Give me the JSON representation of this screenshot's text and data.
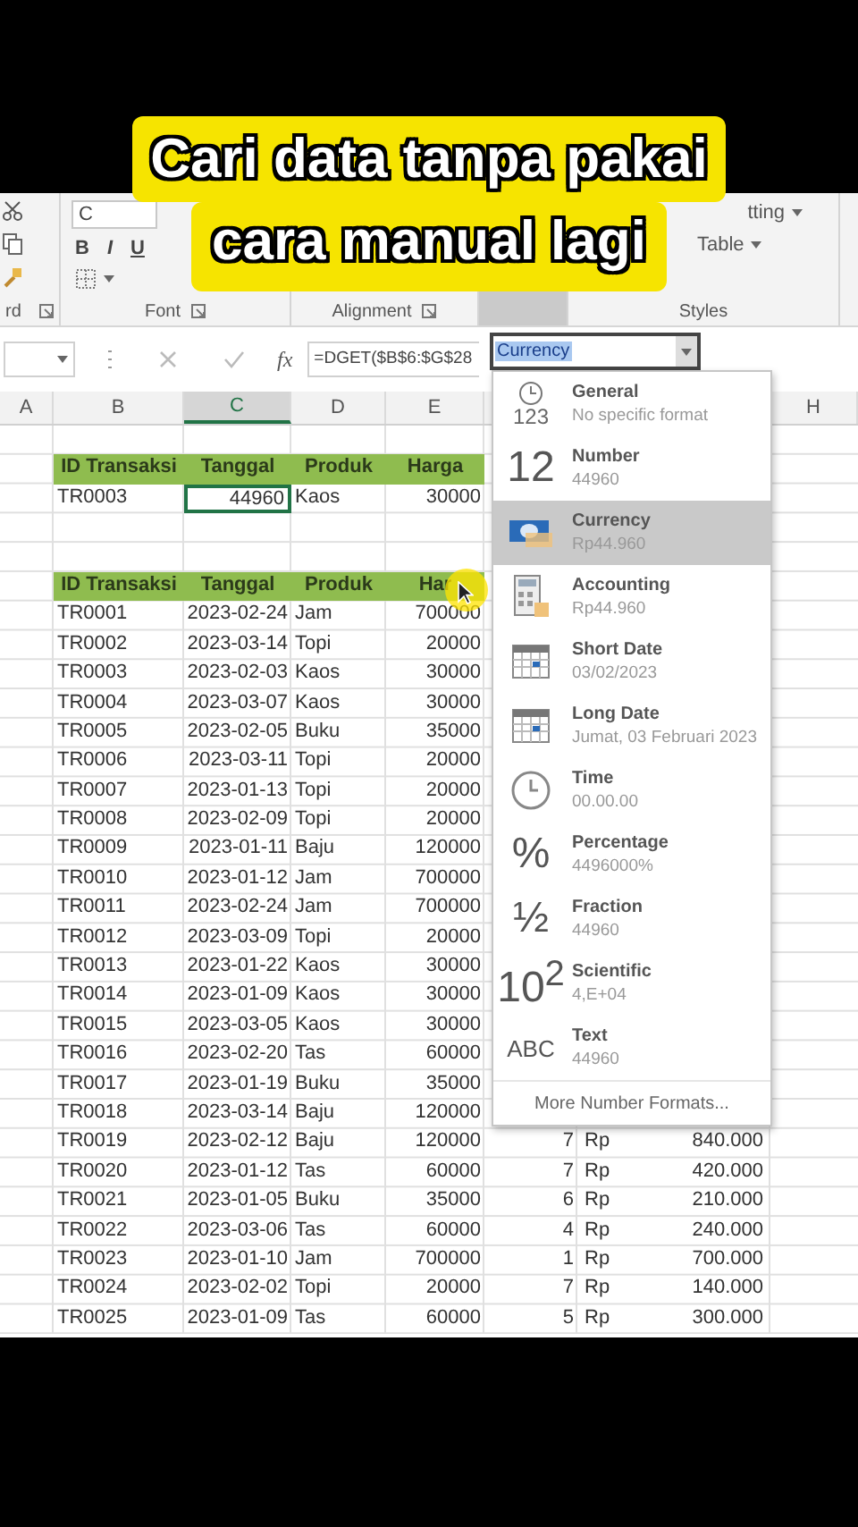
{
  "caption": [
    "Cari data tanpa pakai",
    "cara manual lagi"
  ],
  "ribbon": {
    "font_box": "C",
    "format_buttons": [
      "B",
      "I",
      "U"
    ],
    "styles_buttons": [
      "tting",
      "Table"
    ],
    "group_labels": [
      "rd",
      "Font",
      "Alignment",
      "Styles"
    ]
  },
  "formula_bar": {
    "function_label": "fx",
    "formula": "=DGET($B$6:$G$28"
  },
  "column_headers": [
    {
      "label": "A",
      "selected": false
    },
    {
      "label": "B",
      "selected": false
    },
    {
      "label": "C",
      "selected": true
    },
    {
      "label": "D",
      "selected": false
    },
    {
      "label": "E",
      "selected": false
    },
    {
      "label": "H",
      "selected": false
    }
  ],
  "rows": [
    {
      "kind": "blank"
    },
    {
      "kind": "header",
      "cells": [
        "ID Transaksi",
        "Tanggal",
        "Produk",
        "Harga"
      ]
    },
    {
      "kind": "data",
      "id": "TR0003",
      "date": "44960",
      "product": "Kaos",
      "price": "30000",
      "date_selected": true
    },
    {
      "kind": "blank"
    },
    {
      "kind": "blank"
    },
    {
      "kind": "header",
      "cells": [
        "ID Transaksi",
        "Tanggal",
        "Produk",
        "Har"
      ]
    },
    {
      "kind": "data",
      "id": "TR0001",
      "date": "2023-02-24",
      "product": "Jam",
      "price": "700000",
      "date_selected": false
    },
    {
      "kind": "data",
      "id": "TR0002",
      "date": "2023-03-14",
      "product": "Topi",
      "price": "20000",
      "date_selected": false
    },
    {
      "kind": "data",
      "id": "TR0003",
      "date": "2023-02-03",
      "product": "Kaos",
      "price": "30000",
      "date_selected": false
    },
    {
      "kind": "data",
      "id": "TR0004",
      "date": "2023-03-07",
      "product": "Kaos",
      "price": "30000",
      "date_selected": false
    },
    {
      "kind": "data",
      "id": "TR0005",
      "date": "2023-02-05",
      "product": "Buku",
      "price": "35000",
      "date_selected": false
    },
    {
      "kind": "data",
      "id": "TR0006",
      "date": "2023-03-11",
      "product": "Topi",
      "price": "20000",
      "date_selected": false
    },
    {
      "kind": "data",
      "id": "TR0007",
      "date": "2023-01-13",
      "product": "Topi",
      "price": "20000",
      "date_selected": false
    },
    {
      "kind": "data",
      "id": "TR0008",
      "date": "2023-02-09",
      "product": "Topi",
      "price": "20000",
      "date_selected": false
    },
    {
      "kind": "data",
      "id": "TR0009",
      "date": "2023-01-11",
      "product": "Baju",
      "price": "120000",
      "date_selected": false
    },
    {
      "kind": "data",
      "id": "TR0010",
      "date": "2023-01-12",
      "product": "Jam",
      "price": "700000",
      "date_selected": false
    },
    {
      "kind": "data",
      "id": "TR0011",
      "date": "2023-02-24",
      "product": "Jam",
      "price": "700000",
      "date_selected": false
    },
    {
      "kind": "data",
      "id": "TR0012",
      "date": "2023-03-09",
      "product": "Topi",
      "price": "20000",
      "date_selected": false
    },
    {
      "kind": "data",
      "id": "TR0013",
      "date": "2023-01-22",
      "product": "Kaos",
      "price": "30000",
      "date_selected": false
    },
    {
      "kind": "data",
      "id": "TR0014",
      "date": "2023-01-09",
      "product": "Kaos",
      "price": "30000",
      "date_selected": false
    },
    {
      "kind": "data",
      "id": "TR0015",
      "date": "2023-03-05",
      "product": "Kaos",
      "price": "30000",
      "date_selected": false
    },
    {
      "kind": "data",
      "id": "TR0016",
      "date": "2023-02-20",
      "product": "Tas",
      "price": "60000",
      "date_selected": false
    },
    {
      "kind": "data",
      "id": "TR0017",
      "date": "2023-01-19",
      "product": "Buku",
      "price": "35000",
      "date_selected": false
    },
    {
      "kind": "data",
      "id": "TR0018",
      "date": "2023-03-14",
      "product": "Baju",
      "price": "120000",
      "date_selected": false
    },
    {
      "kind": "data",
      "id": "TR0019",
      "date": "2023-02-12",
      "product": "Baju",
      "price": "120000",
      "qty": "7",
      "symbol": "Rp",
      "total": "840.000",
      "date_selected": false
    },
    {
      "kind": "data",
      "id": "TR0020",
      "date": "2023-01-12",
      "product": "Tas",
      "price": "60000",
      "qty": "7",
      "symbol": "Rp",
      "total": "420.000",
      "date_selected": false
    },
    {
      "kind": "data",
      "id": "TR0021",
      "date": "2023-01-05",
      "product": "Buku",
      "price": "35000",
      "qty": "6",
      "symbol": "Rp",
      "total": "210.000",
      "date_selected": false
    },
    {
      "kind": "data",
      "id": "TR0022",
      "date": "2023-03-06",
      "product": "Tas",
      "price": "60000",
      "qty": "4",
      "symbol": "Rp",
      "total": "240.000",
      "date_selected": false
    },
    {
      "kind": "data",
      "id": "TR0023",
      "date": "2023-01-10",
      "product": "Jam",
      "price": "700000",
      "qty": "1",
      "symbol": "Rp",
      "total": "700.000",
      "date_selected": false
    },
    {
      "kind": "data",
      "id": "TR0024",
      "date": "2023-02-02",
      "product": "Topi",
      "price": "20000",
      "qty": "7",
      "symbol": "Rp",
      "total": "140.000",
      "date_selected": false
    },
    {
      "kind": "data",
      "id": "TR0025",
      "date": "2023-01-09",
      "product": "Tas",
      "price": "60000",
      "qty": "5",
      "symbol": "Rp",
      "total": "300.000",
      "date_selected": false
    }
  ],
  "number_format": {
    "value": "Currency",
    "options": [
      {
        "kind": "clock-digits",
        "icon_text": "123",
        "title": "General",
        "sample": "No specific format",
        "selected": false
      },
      {
        "kind": "glyph",
        "icon_text": "12",
        "title": "Number",
        "sample": "44960",
        "selected": false
      },
      {
        "kind": "banknote",
        "title": "Currency",
        "sample": "Rp44.960",
        "selected": true
      },
      {
        "kind": "calculator",
        "title": "Accounting",
        "sample": "Rp44.960",
        "selected": false
      },
      {
        "kind": "calendar",
        "title": "Short Date",
        "sample": "03/02/2023",
        "selected": false
      },
      {
        "kind": "calendar",
        "title": "Long Date",
        "sample": "Jumat, 03 Februari 2023",
        "selected": false
      },
      {
        "kind": "clock",
        "title": "Time",
        "sample": "00.00.00",
        "selected": false
      },
      {
        "kind": "glyph",
        "icon_text": "%",
        "title": "Percentage",
        "sample": "4496000%",
        "selected": false
      },
      {
        "kind": "glyph",
        "icon_text": "½",
        "title": "Fraction",
        "sample": "44960",
        "selected": false
      },
      {
        "kind": "glyph",
        "icon_text": "10$^{2}$",
        "title": "Scientific",
        "sample": "4,E+04",
        "selected": false
      },
      {
        "kind": "glyph-small",
        "icon_text": "ABC",
        "title": "Text",
        "sample": "44960",
        "selected": false
      }
    ],
    "footer": "More Number Formats..."
  }
}
